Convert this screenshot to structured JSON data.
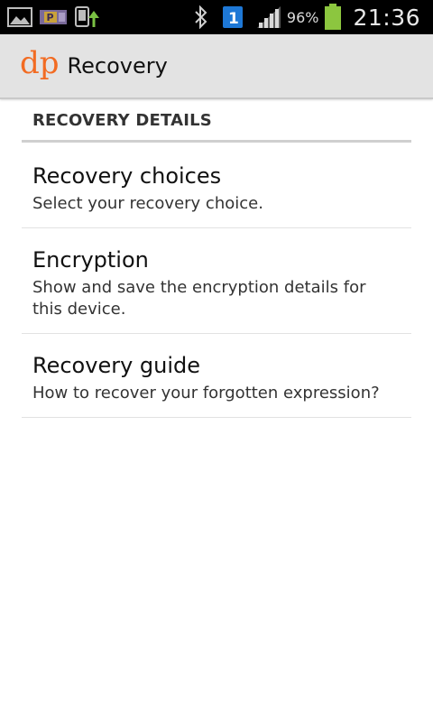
{
  "status_bar": {
    "left_icons": [
      "gallery-icon",
      "parking-app-icon",
      "phone-upload-icon"
    ],
    "right_icons": [
      "bluetooth-icon",
      "notification-1-icon",
      "signal-icon",
      "battery-icon"
    ],
    "notification_badge": "1",
    "battery_percent": "96%",
    "battery_level": 0.96,
    "battery_color": "#8cc63f",
    "time": "21:36"
  },
  "action_bar": {
    "logo": "dp",
    "logo_color": "#f26b22",
    "title": "Recovery"
  },
  "section": {
    "header": "RECOVERY DETAILS",
    "items": [
      {
        "title": "Recovery choices",
        "summary": "Select your recovery choice."
      },
      {
        "title": "Encryption",
        "summary": "Show and save the encryption details for this device."
      },
      {
        "title": "Recovery guide",
        "summary": "How to recover your forgotten expression?"
      }
    ]
  }
}
